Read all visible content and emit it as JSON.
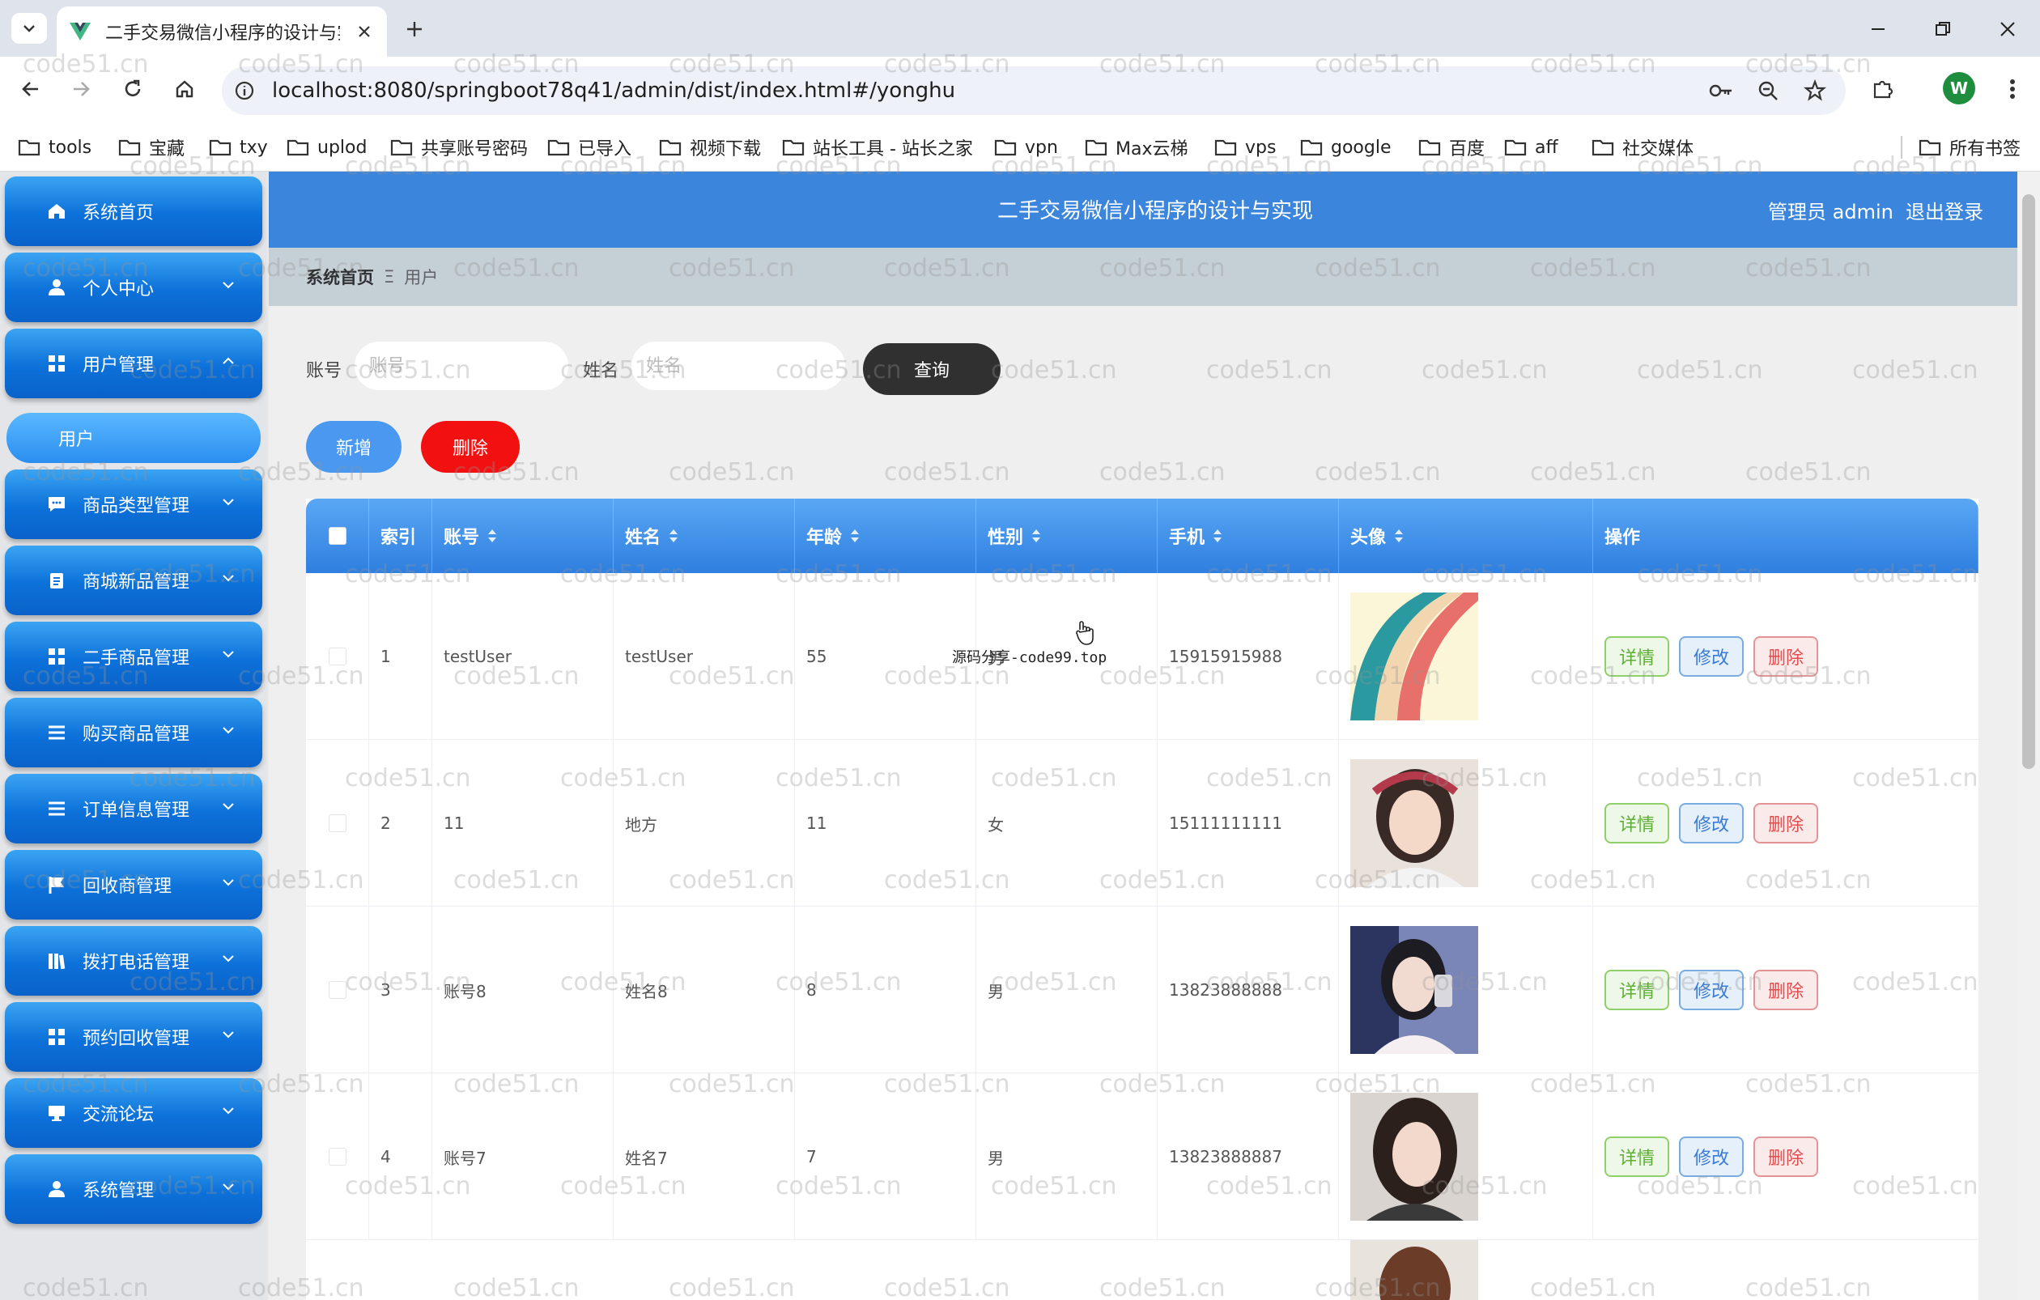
{
  "browser": {
    "tab_title": "二手交易微信小程序的设计与实",
    "url": "localhost:8080/springboot78q41/admin/dist/index.html#/yonghu",
    "profile_initial": "W",
    "bookmarks": [
      "tools",
      "宝藏",
      "txy",
      "uplod",
      "共享账号密码",
      "已导入",
      "视频下载",
      "站长工具 - 站长之家",
      "vpn",
      "Max云梯",
      "vps",
      "google",
      "百度",
      "aff",
      "社交媒体"
    ],
    "all_bookmarks_label": "所有书签"
  },
  "header": {
    "title": "二手交易微信小程序的设计与实现",
    "user": "管理员 admin",
    "logout": "退出登录"
  },
  "sidebar": {
    "items": [
      {
        "label": "系统首页",
        "icon": "home-icon"
      },
      {
        "label": "个人中心",
        "icon": "person-icon"
      },
      {
        "label": "用户管理",
        "icon": "grid-icon"
      },
      {
        "label": "商品类型管理",
        "icon": "chat-icon"
      },
      {
        "label": "商城新品管理",
        "icon": "clipboard-icon"
      },
      {
        "label": "二手商品管理",
        "icon": "grid-icon"
      },
      {
        "label": "购买商品管理",
        "icon": "list-icon"
      },
      {
        "label": "订单信息管理",
        "icon": "list-icon"
      },
      {
        "label": "回收商管理",
        "icon": "flag-icon"
      },
      {
        "label": "拨打电话管理",
        "icon": "book-icon"
      },
      {
        "label": "预约回收管理",
        "icon": "grid-icon"
      },
      {
        "label": "交流论坛",
        "icon": "monitor-icon"
      },
      {
        "label": "系统管理",
        "icon": "person-icon"
      }
    ],
    "active_sub": "用户"
  },
  "breadcrumb": {
    "home": "系统首页",
    "separator": "Ξ",
    "current": "用户"
  },
  "search": {
    "account_label": "账号",
    "account_placeholder": "账号",
    "name_label": "姓名",
    "name_placeholder": "姓名",
    "query_button": "查询"
  },
  "actions": {
    "add": "新增",
    "delete": "删除"
  },
  "table": {
    "columns": [
      "索引",
      "账号",
      "姓名",
      "年龄",
      "性别",
      "手机",
      "头像",
      "操作"
    ],
    "rows": [
      {
        "index": "1",
        "account": "testUser",
        "name": "testUser",
        "age": "55",
        "gender": "男",
        "phone": "15915915988"
      },
      {
        "index": "2",
        "account": "11",
        "name": "地方",
        "age": "11",
        "gender": "女",
        "phone": "15111111111"
      },
      {
        "index": "3",
        "account": "账号8",
        "name": "姓名8",
        "age": "8",
        "gender": "男",
        "phone": "13823888888"
      },
      {
        "index": "4",
        "account": "账号7",
        "name": "姓名7",
        "age": "7",
        "gender": "男",
        "phone": "13823888887"
      }
    ],
    "row_actions": {
      "detail": "详情",
      "edit": "修改",
      "delete": "删除"
    }
  },
  "overlay_text": "源码分享-code99.top",
  "watermark": "code51.cn"
}
